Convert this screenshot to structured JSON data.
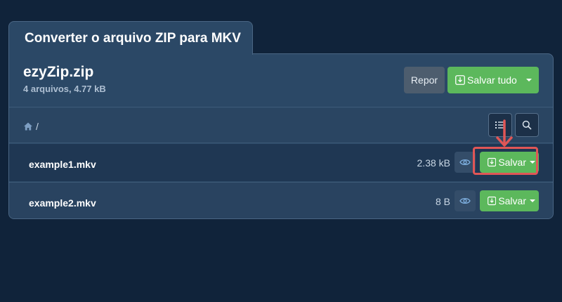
{
  "tab": {
    "title": "Converter o arquivo ZIP para MKV"
  },
  "archive": {
    "name": "ezyZip.zip",
    "meta": "4 arquivos, 4.77 kB",
    "reset_label": "Repor",
    "save_all_label": "Salvar tudo"
  },
  "breadcrumb": {
    "path": "/"
  },
  "files": [
    {
      "name": "example1.mkv",
      "size": "2.38 kB",
      "save_label": "Salvar"
    },
    {
      "name": "example2.mkv",
      "size": "8 B",
      "save_label": "Salvar"
    }
  ],
  "icons": {
    "home": "home-icon",
    "list": "list-icon",
    "search": "search-icon",
    "eye": "eye-icon",
    "download": "download-icon",
    "caret": "caret-down-icon",
    "annotation_arrow": "arrow-down-icon"
  },
  "colors": {
    "background": "#10233a",
    "panel": "#2b4866",
    "success": "#5cb85c",
    "secondary": "#4d5d6e",
    "highlight": "#e05656"
  }
}
